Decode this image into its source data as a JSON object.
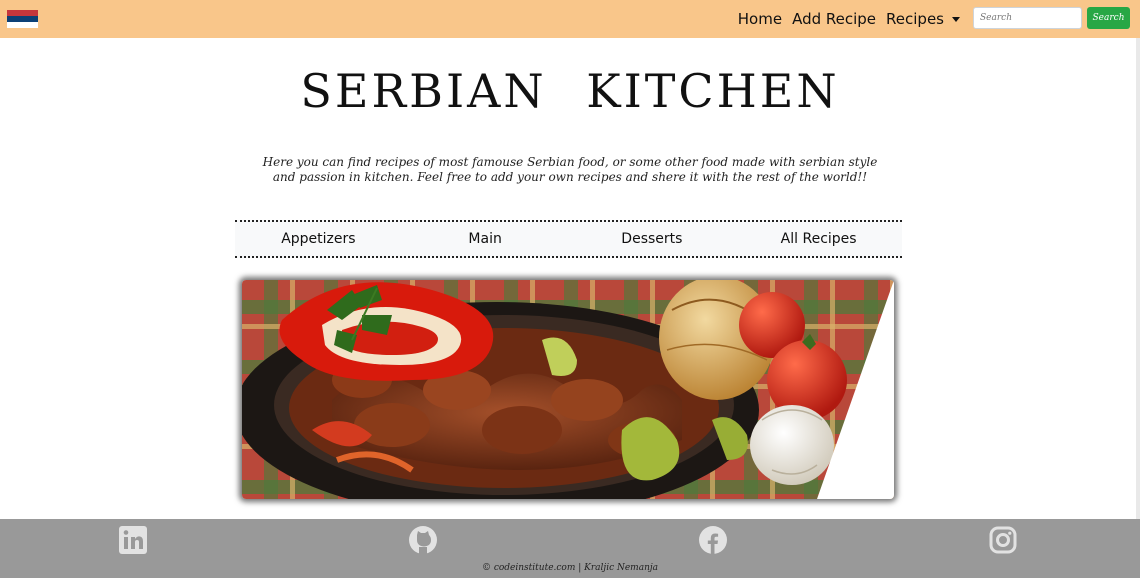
{
  "navbar": {
    "flag_colors": [
      "#c6363c",
      "#0c4076",
      "#ffffff"
    ],
    "background": "#f9c68a",
    "links": {
      "home": "Home",
      "add_recipe": "Add Recipe",
      "recipes": "Recipes"
    },
    "search": {
      "placeholder": "Search",
      "button_label": "Search"
    }
  },
  "hero": {
    "title": "SERBIAN KITCHEN",
    "intro": "Here you can find recipes of most famouse Serbian food, or some other food made with serbian style and passion in kitchen. Feel free to add your own recipes and shere it with the rest of the world!!"
  },
  "categories": {
    "items": [
      "Appetizers",
      "Main",
      "Desserts",
      "All Recipes"
    ]
  },
  "footer": {
    "icons": [
      "linkedin-icon",
      "github-icon",
      "facebook-icon",
      "instagram-icon"
    ],
    "copyright": "© codeinstitute.com | Kraljic Nemanja",
    "background": "#999999"
  }
}
